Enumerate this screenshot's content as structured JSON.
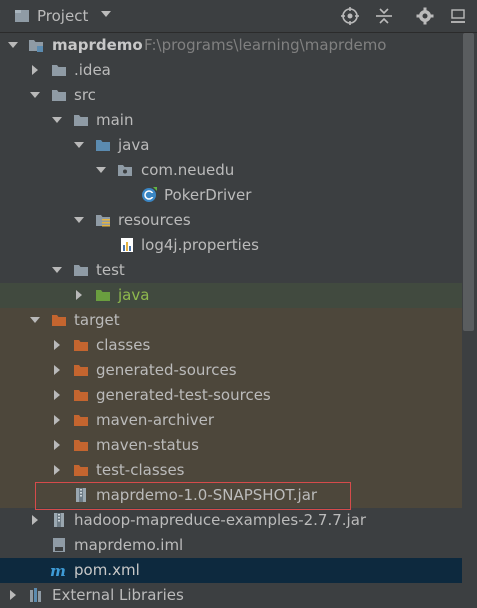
{
  "header": {
    "title": "Project",
    "icons": [
      "locate-icon",
      "collapse-all-icon",
      "settings-icon",
      "hide-icon"
    ]
  },
  "tree": {
    "project": {
      "name": "maprdemo",
      "path": "F:\\programs\\learning\\maprdemo"
    },
    "idea": ".idea",
    "src": "src",
    "main": "main",
    "java": "java",
    "package": "com.neuedu",
    "driver": "PokerDriver",
    "resources": "resources",
    "log4j": "log4j.properties",
    "test": "test",
    "test_java": "java",
    "target": "target",
    "classes": "classes",
    "gen_sources": "generated-sources",
    "gen_test_sources": "generated-test-sources",
    "maven_archiver": "maven-archiver",
    "maven_status": "maven-status",
    "test_classes": "test-classes",
    "snapshot_jar": "maprdemo-1.0-SNAPSHOT.jar",
    "examples_jar": "hadoop-mapreduce-examples-2.7.7.jar",
    "iml": "maprdemo.iml",
    "pom": "pom.xml",
    "ext_libs": "External Libraries"
  },
  "colors": {
    "folder": "#8f9ba5",
    "source_folder": "#5b8bb0",
    "test_folder": "#6a9e3f",
    "excluded_folder": "#c4652f",
    "highlight": "#d64b4b"
  }
}
